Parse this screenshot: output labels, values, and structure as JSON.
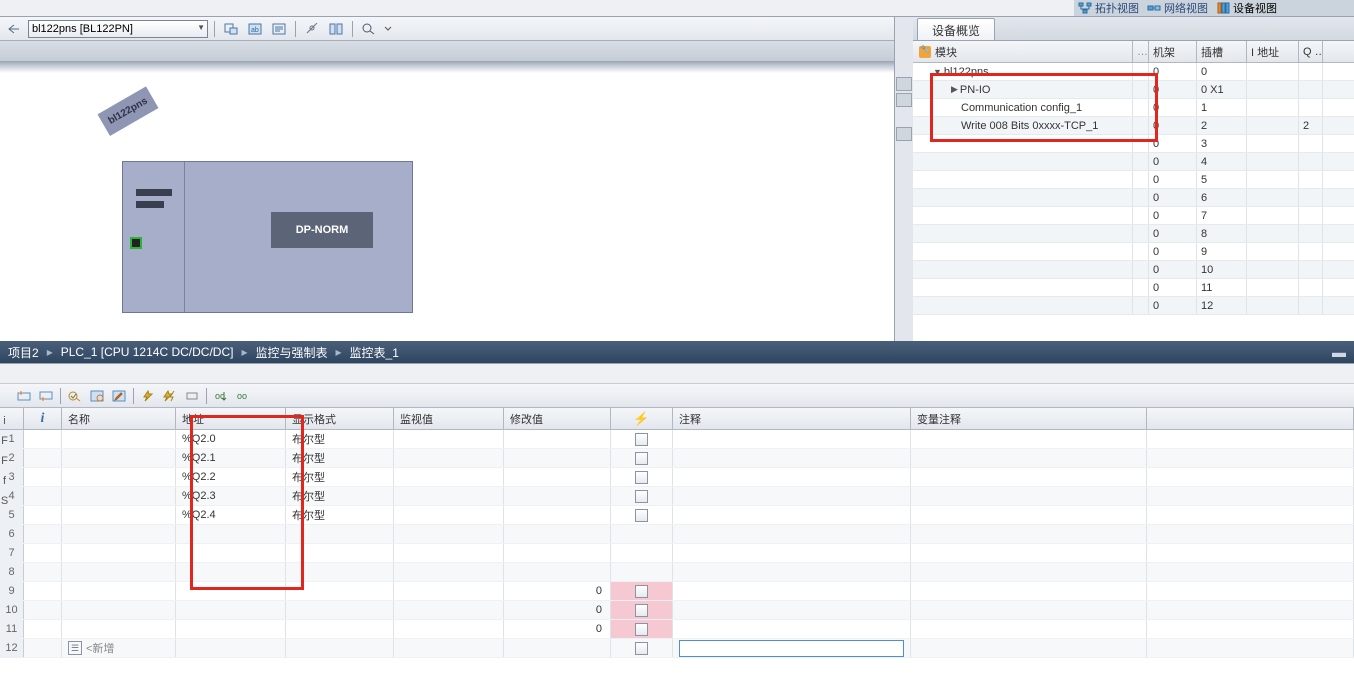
{
  "view_tabs": {
    "topology": "拓扑视图",
    "network": "网络视图",
    "device": "设备视图"
  },
  "device_view": {
    "dropdown": "bl122pns [BL122PN]",
    "flag_label": "bl122pns",
    "dp_label": "DP-NORM"
  },
  "overview": {
    "tab": "设备概览",
    "headers": {
      "module": "模块",
      "rack": "机架",
      "slot": "插槽",
      "iaddr": "I 地址",
      "q": "Q …"
    },
    "rows": [
      {
        "indent": 0,
        "arrow": "▼",
        "module": "bl122pns",
        "rack": "0",
        "slot": "0",
        "iaddr": "",
        "q": ""
      },
      {
        "indent": 1,
        "arrow": "▶",
        "module": "PN-IO",
        "rack": "0",
        "slot": "0 X1",
        "iaddr": "",
        "q": ""
      },
      {
        "indent": 1,
        "arrow": "",
        "module": "Communication config_1",
        "rack": "0",
        "slot": "1",
        "iaddr": "",
        "q": ""
      },
      {
        "indent": 1,
        "arrow": "",
        "module": "Write 008 Bits 0xxxx-TCP_1",
        "rack": "0",
        "slot": "2",
        "iaddr": "",
        "q": "2"
      },
      {
        "indent": 1,
        "arrow": "",
        "module": "",
        "rack": "0",
        "slot": "3",
        "iaddr": "",
        "q": ""
      },
      {
        "indent": 1,
        "arrow": "",
        "module": "",
        "rack": "0",
        "slot": "4",
        "iaddr": "",
        "q": ""
      },
      {
        "indent": 1,
        "arrow": "",
        "module": "",
        "rack": "0",
        "slot": "5",
        "iaddr": "",
        "q": ""
      },
      {
        "indent": 1,
        "arrow": "",
        "module": "",
        "rack": "0",
        "slot": "6",
        "iaddr": "",
        "q": ""
      },
      {
        "indent": 1,
        "arrow": "",
        "module": "",
        "rack": "0",
        "slot": "7",
        "iaddr": "",
        "q": ""
      },
      {
        "indent": 1,
        "arrow": "",
        "module": "",
        "rack": "0",
        "slot": "8",
        "iaddr": "",
        "q": ""
      },
      {
        "indent": 1,
        "arrow": "",
        "module": "",
        "rack": "0",
        "slot": "9",
        "iaddr": "",
        "q": ""
      },
      {
        "indent": 1,
        "arrow": "",
        "module": "",
        "rack": "0",
        "slot": "10",
        "iaddr": "",
        "q": ""
      },
      {
        "indent": 1,
        "arrow": "",
        "module": "",
        "rack": "0",
        "slot": "11",
        "iaddr": "",
        "q": ""
      },
      {
        "indent": 1,
        "arrow": "",
        "module": "",
        "rack": "0",
        "slot": "12",
        "iaddr": "",
        "q": ""
      }
    ]
  },
  "breadcrumb": {
    "p1": "项目2",
    "p2": "PLC_1 [CPU 1214C DC/DC/DC]",
    "p3": "监控与强制表",
    "p4": "监控表_1"
  },
  "watch": {
    "headers": {
      "i": "i",
      "name": "名称",
      "addr": "地址",
      "fmt": "显示格式",
      "mon": "监视值",
      "mod": "修改值",
      "flash": "⚡",
      "note": "注释",
      "vnote": "变量注释"
    },
    "rows": [
      {
        "n": "1",
        "addr": "%Q2.0",
        "fmt": "布尔型",
        "mod": "",
        "chk": true
      },
      {
        "n": "2",
        "addr": "%Q2.1",
        "fmt": "布尔型",
        "mod": "",
        "chk": true
      },
      {
        "n": "3",
        "addr": "%Q2.2",
        "fmt": "布尔型",
        "mod": "",
        "chk": true
      },
      {
        "n": "4",
        "addr": "%Q2.3",
        "fmt": "布尔型",
        "mod": "",
        "chk": true
      },
      {
        "n": "5",
        "addr": "%Q2.4",
        "fmt": "布尔型",
        "mod": "",
        "chk": true
      },
      {
        "n": "6",
        "addr": "",
        "fmt": "",
        "mod": "",
        "chk": false
      },
      {
        "n": "7",
        "addr": "",
        "fmt": "",
        "mod": "",
        "chk": false
      },
      {
        "n": "8",
        "addr": "",
        "fmt": "",
        "mod": "",
        "chk": false
      },
      {
        "n": "9",
        "addr": "",
        "fmt": "",
        "mod": "0",
        "chk": true,
        "pink": true
      },
      {
        "n": "10",
        "addr": "",
        "fmt": "",
        "mod": "0",
        "chk": true,
        "pink": true
      },
      {
        "n": "11",
        "addr": "",
        "fmt": "",
        "mod": "0",
        "chk": true,
        "pink": true
      },
      {
        "n": "12",
        "addr": "",
        "fmt": "",
        "mod": "",
        "chk": true,
        "add": true
      }
    ],
    "add_placeholder": "<新增"
  },
  "edge_letters": [
    "i",
    "F",
    "F",
    "f",
    "S"
  ]
}
